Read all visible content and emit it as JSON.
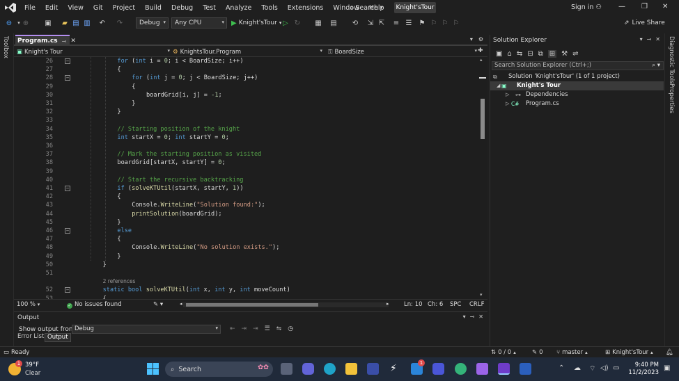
{
  "menubar": {
    "items": [
      "File",
      "Edit",
      "View",
      "Git",
      "Project",
      "Build",
      "Debug",
      "Test",
      "Analyze",
      "Tools",
      "Extensions",
      "Window",
      "Help"
    ],
    "search_label": "Search",
    "solution_badge": "Knight'sTour",
    "sign_in": "Sign in"
  },
  "toolbar": {
    "config": "Debug",
    "platform": "Any CPU",
    "run_target": "Knight'sTour",
    "live_share": "Live Share"
  },
  "left_tab": "Toolbox",
  "right_tabs": [
    "Diagnostic Tools",
    "Properties"
  ],
  "editor": {
    "tab_name": "Program.cs",
    "nav_project": "Knight's Tour",
    "nav_class": "KnightsTour.Program",
    "nav_member": "BoardSize",
    "lines": [
      {
        "n": "26",
        "fold": "−",
        "indent": 3,
        "tokens": [
          [
            "kw",
            "for"
          ],
          [
            "t",
            " ("
          ],
          [
            "kw",
            "int"
          ],
          [
            "t",
            " i = "
          ],
          [
            "nu",
            "0"
          ],
          [
            "t",
            "; i < BoardSize; i++)"
          ]
        ]
      },
      {
        "n": "27",
        "indent": 3,
        "tokens": [
          [
            "t",
            "{"
          ]
        ]
      },
      {
        "n": "28",
        "fold": "−",
        "indent": 4,
        "tokens": [
          [
            "kw",
            "for"
          ],
          [
            "t",
            " ("
          ],
          [
            "kw",
            "int"
          ],
          [
            "t",
            " j = "
          ],
          [
            "nu",
            "0"
          ],
          [
            "t",
            "; j < BoardSize; j++)"
          ]
        ]
      },
      {
        "n": "29",
        "indent": 4,
        "tokens": [
          [
            "t",
            "{"
          ]
        ]
      },
      {
        "n": "30",
        "indent": 5,
        "tokens": [
          [
            "t",
            "boardGrid[i, j] = "
          ],
          [
            "nu",
            "-1"
          ],
          [
            "t",
            ";"
          ]
        ]
      },
      {
        "n": "31",
        "indent": 4,
        "tokens": [
          [
            "t",
            "}"
          ]
        ]
      },
      {
        "n": "32",
        "indent": 3,
        "tokens": [
          [
            "t",
            "}"
          ]
        ]
      },
      {
        "n": "33",
        "indent": 0,
        "tokens": []
      },
      {
        "n": "34",
        "indent": 3,
        "tokens": [
          [
            "cm",
            "// Starting position of the knight"
          ]
        ]
      },
      {
        "n": "35",
        "indent": 3,
        "tokens": [
          [
            "kw",
            "int"
          ],
          [
            "t",
            " startX = "
          ],
          [
            "nu",
            "0"
          ],
          [
            "t",
            "; "
          ],
          [
            "kw",
            "int"
          ],
          [
            "t",
            " startY = "
          ],
          [
            "nu",
            "0"
          ],
          [
            "t",
            ";"
          ]
        ]
      },
      {
        "n": "36",
        "indent": 0,
        "tokens": []
      },
      {
        "n": "37",
        "indent": 3,
        "tokens": [
          [
            "cm",
            "// Mark the starting position as visited"
          ]
        ]
      },
      {
        "n": "38",
        "indent": 3,
        "tokens": [
          [
            "t",
            "boardGrid[startX, startY] = "
          ],
          [
            "nu",
            "0"
          ],
          [
            "t",
            ";"
          ]
        ]
      },
      {
        "n": "39",
        "indent": 0,
        "tokens": []
      },
      {
        "n": "40",
        "indent": 3,
        "tokens": [
          [
            "cm",
            "// Start the recursive backtracking"
          ]
        ]
      },
      {
        "n": "41",
        "fold": "−",
        "indent": 3,
        "tokens": [
          [
            "kw",
            "if"
          ],
          [
            "t",
            " ("
          ],
          [
            "fn",
            "solveKTUtil"
          ],
          [
            "t",
            "(startX, startY, "
          ],
          [
            "nu",
            "1"
          ],
          [
            "t",
            "))"
          ]
        ]
      },
      {
        "n": "42",
        "indent": 3,
        "tokens": [
          [
            "t",
            "{"
          ]
        ]
      },
      {
        "n": "43",
        "indent": 4,
        "tokens": [
          [
            "t",
            "Console."
          ],
          [
            "fn",
            "WriteLine"
          ],
          [
            "t",
            "("
          ],
          [
            "st",
            "\"Solution found:\""
          ],
          [
            "t",
            ");"
          ]
        ]
      },
      {
        "n": "44",
        "indent": 4,
        "tokens": [
          [
            "fn",
            "printSolution"
          ],
          [
            "t",
            "(boardGrid);"
          ]
        ]
      },
      {
        "n": "45",
        "indent": 3,
        "tokens": [
          [
            "t",
            "}"
          ]
        ]
      },
      {
        "n": "46",
        "fold": "−",
        "indent": 3,
        "tokens": [
          [
            "kw",
            "else"
          ]
        ]
      },
      {
        "n": "47",
        "indent": 3,
        "tokens": [
          [
            "t",
            "{"
          ]
        ]
      },
      {
        "n": "48",
        "indent": 4,
        "tokens": [
          [
            "t",
            "Console."
          ],
          [
            "fn",
            "WriteLine"
          ],
          [
            "t",
            "("
          ],
          [
            "st",
            "\"No solution exists.\""
          ],
          [
            "t",
            ");"
          ]
        ]
      },
      {
        "n": "49",
        "indent": 3,
        "tokens": [
          [
            "t",
            "}"
          ]
        ]
      },
      {
        "n": "50",
        "indent": 2,
        "tokens": [
          [
            "t",
            "}"
          ]
        ]
      },
      {
        "n": "51",
        "indent": 0,
        "tokens": []
      },
      {
        "n": "",
        "indent": 2,
        "hint": true,
        "tokens": [
          [
            "h",
            "2 references"
          ]
        ]
      },
      {
        "n": "52",
        "fold": "−",
        "indent": 2,
        "tokens": [
          [
            "kw",
            "static"
          ],
          [
            "t",
            " "
          ],
          [
            "kw",
            "bool"
          ],
          [
            "t",
            " "
          ],
          [
            "fn",
            "solveKTUtil"
          ],
          [
            "t",
            "("
          ],
          [
            "kw",
            "int"
          ],
          [
            "t",
            " x, "
          ],
          [
            "kw",
            "int"
          ],
          [
            "t",
            " y, "
          ],
          [
            "kw",
            "int"
          ],
          [
            "t",
            " moveCount)"
          ]
        ]
      },
      {
        "n": "53",
        "indent": 2,
        "tokens": [
          [
            "t",
            "{"
          ]
        ]
      }
    ]
  },
  "editor_status": {
    "zoom": "100 %",
    "issues": "No issues found",
    "line": "Ln: 10",
    "col": "Ch: 6",
    "spacing": "SPC",
    "eol": "CRLF"
  },
  "output": {
    "title": "Output",
    "show_from_label": "Show output from:",
    "source": "Debug",
    "tabs": [
      "Error List",
      "Output"
    ]
  },
  "solution_explorer": {
    "title": "Solution Explorer",
    "search_placeholder": "Search Solution Explorer (Ctrl+;)",
    "solution": "Solution 'Knight'sTour' (1 of 1 project)",
    "project": "Knight's Tour",
    "dependencies": "Dependencies",
    "file": "Program.cs"
  },
  "statusbar": {
    "ready": "Ready",
    "changes": "0 / 0",
    "commits": "0",
    "branch": "master",
    "repo": "Knight'sTour"
  },
  "taskbar": {
    "temp": "39°F",
    "condition": "Clear",
    "weather_badge": "1",
    "search": "Search",
    "time": "9:40 PM",
    "date": "11/2/2023",
    "mail_badge": "1"
  },
  "colors": {
    "accent": "#b48ef0",
    "keyword": "#569cd6",
    "comment": "#57a64a",
    "string": "#d69d85",
    "method": "#dcdcaa",
    "ok": "#3fa34d"
  }
}
